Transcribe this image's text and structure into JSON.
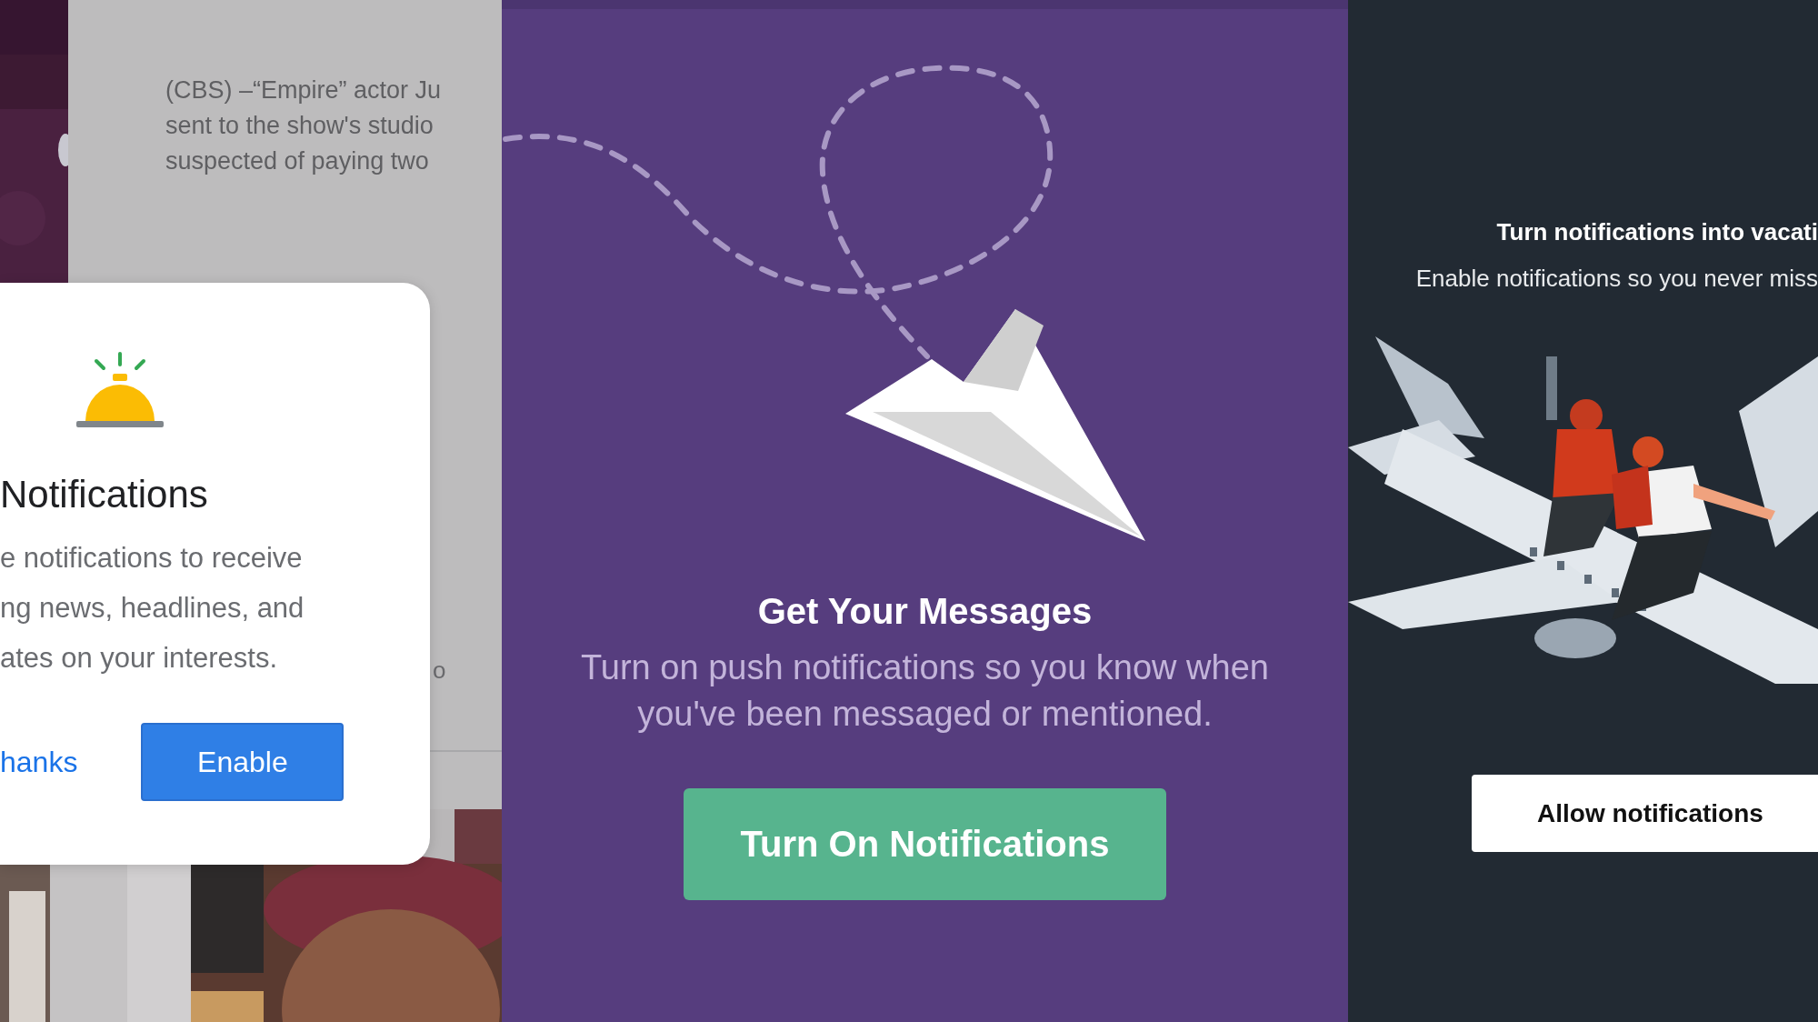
{
  "article": {
    "lines": [
      "(CBS) –“Empire” actor Ju",
      "sent to the show's studio",
      "suspected of paying two"
    ],
    "fragment": "o"
  },
  "dialog": {
    "title": "Notifications",
    "body_lines": [
      "e notifications to receive",
      "ng news, headlines, and",
      "ates on your interests."
    ],
    "buttons": [
      {
        "label": "hanks",
        "kind": "text"
      },
      {
        "label": "Enable",
        "kind": "filled"
      }
    ]
  },
  "slack": {
    "title": "Get Your Messages",
    "body": "Turn on push notifications so you know when you've been messaged or mentioned.",
    "button": "Turn On Notifications"
  },
  "travel": {
    "title": "Turn notifications into vacati",
    "subtitle": "Enable notifications so you never miss",
    "button": "Allow notifications"
  }
}
